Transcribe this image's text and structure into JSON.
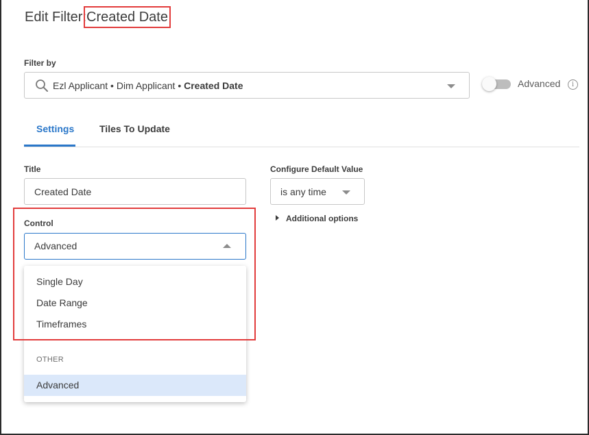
{
  "header": {
    "prefix": "Edit Filter:",
    "filter_name": "Created Date"
  },
  "filter_by": {
    "label": "Filter by",
    "path_prefix": "Ezl Applicant • Dim Applicant • ",
    "path_field": "Created Date",
    "icon": "search-icon"
  },
  "advanced_toggle": {
    "label": "Advanced",
    "enabled": false,
    "info_icon_glyph": "i"
  },
  "tabs": [
    {
      "label": "Settings",
      "active": true
    },
    {
      "label": "Tiles To Update",
      "active": false
    }
  ],
  "settings": {
    "title_label": "Title",
    "title_value": "Created Date",
    "default_value_label": "Configure Default Value",
    "default_value": "is any time",
    "additional_options": "Additional options",
    "control_label": "Control",
    "control_value": "Advanced"
  },
  "control_dropdown": {
    "options": [
      "Single Day",
      "Date Range",
      "Timeframes"
    ],
    "group_label": "OTHER",
    "other_options": [
      "Advanced"
    ],
    "selected": "Advanced"
  },
  "colors": {
    "accent": "#2a77c9",
    "highlight": "#e23b3b",
    "selected_bg": "#dbe8fa"
  }
}
